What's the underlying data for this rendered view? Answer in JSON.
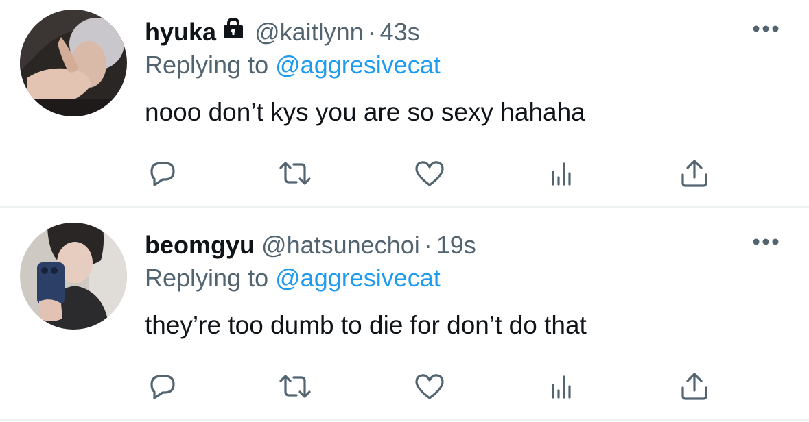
{
  "colors": {
    "text_primary": "#0f1419",
    "text_secondary": "#536471",
    "link": "#1d9bf0",
    "divider": "#eff3f4",
    "icon": "#536471"
  },
  "tweets": [
    {
      "display_name": "hyuka",
      "protected_icon": "lock-icon",
      "handle": "@kaitlynn",
      "separator": "·",
      "time": "43s",
      "reply_prefix": "Replying to",
      "reply_to": "@aggresivecat",
      "text": "nooo don’t kys you are so sexy hahaha",
      "actions": [
        "reply-icon",
        "retweet-icon",
        "like-icon",
        "views-icon",
        "share-icon"
      ],
      "more_icon": "more-icon"
    },
    {
      "display_name": "beomgyu",
      "handle": "@hatsunechoi",
      "separator": "·",
      "time": "19s",
      "reply_prefix": "Replying to",
      "reply_to": "@aggresivecat",
      "text": "they’re too dumb to die for don’t do that",
      "actions": [
        "reply-icon",
        "retweet-icon",
        "like-icon",
        "views-icon",
        "share-icon"
      ],
      "more_icon": "more-icon"
    }
  ]
}
